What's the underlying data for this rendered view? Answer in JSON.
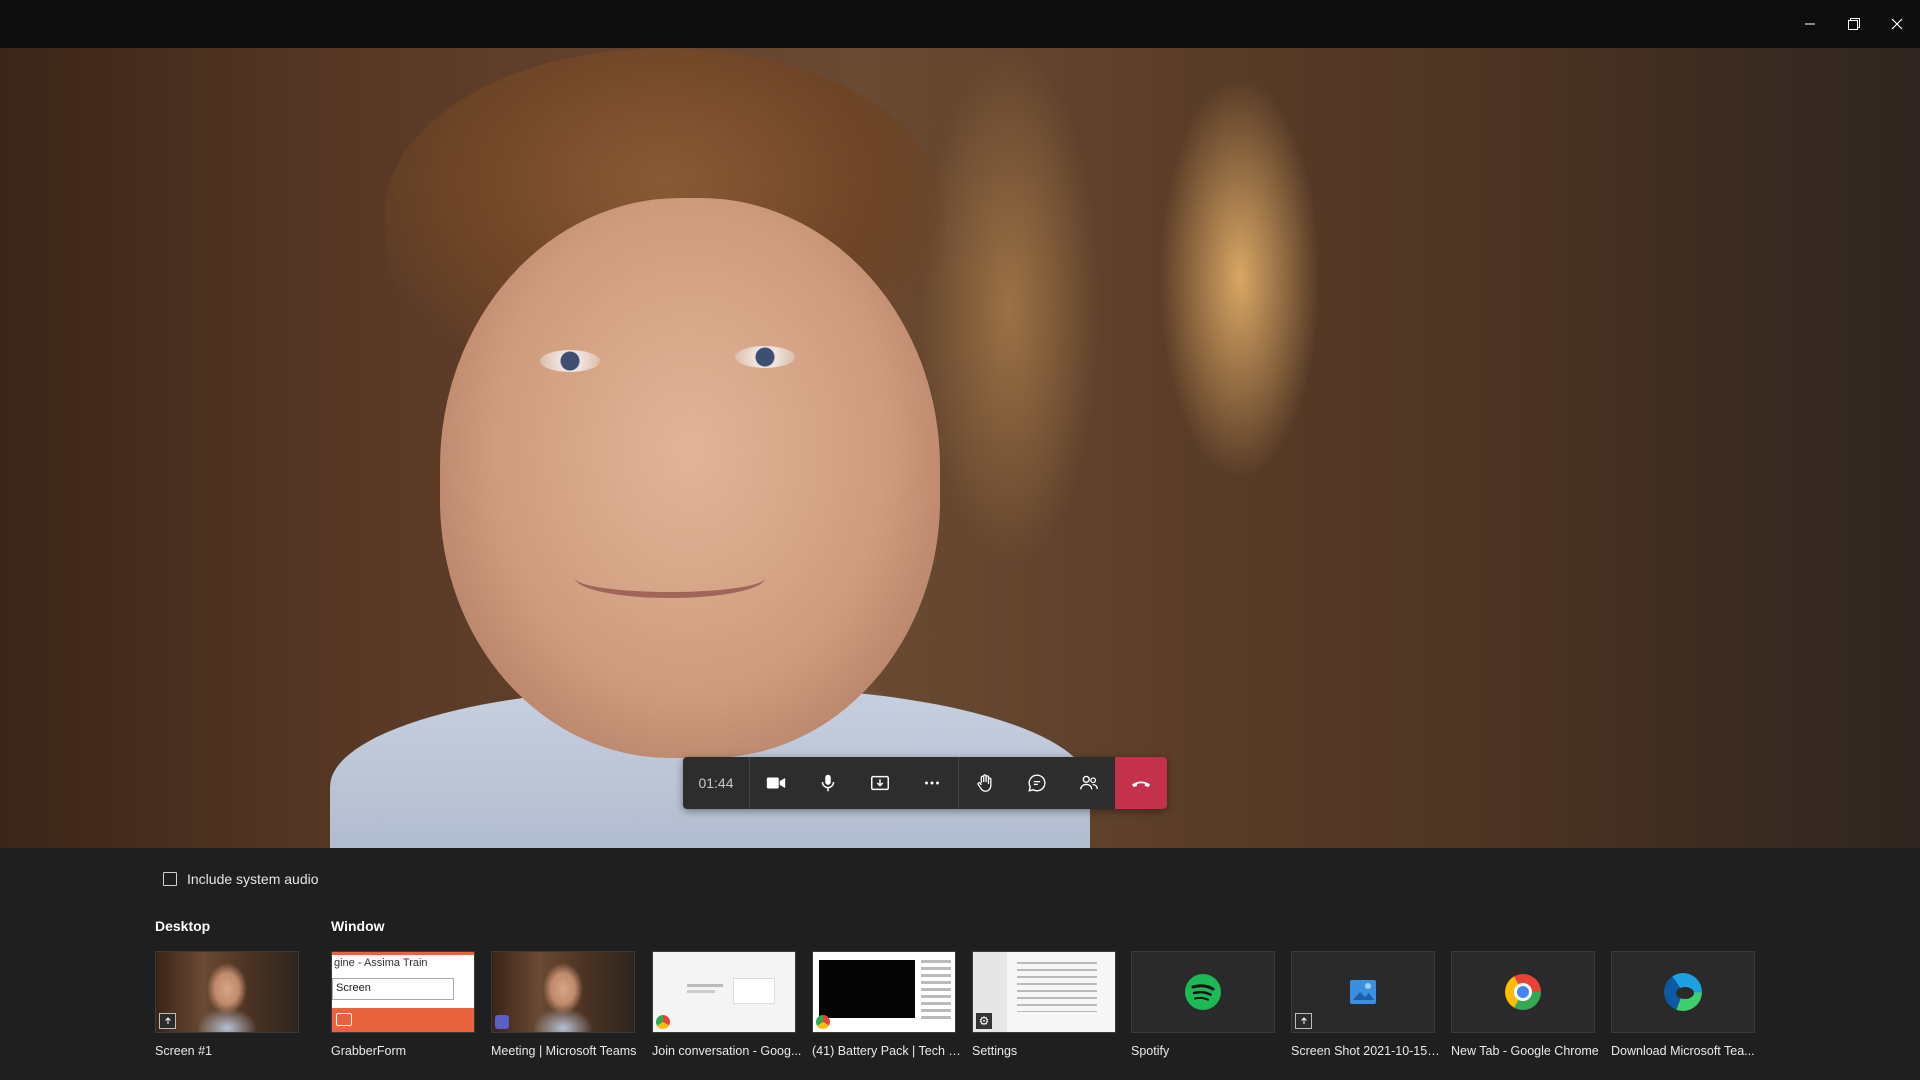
{
  "call": {
    "timer": "01:44"
  },
  "share_tray": {
    "include_audio_label": "Include system audio",
    "desktop_heading": "Desktop",
    "window_heading": "Window",
    "desktop_items": [
      {
        "label": "Screen #1"
      }
    ],
    "window_items": [
      {
        "label": "GrabberForm",
        "thumb_text_1": "gine - Assima Train",
        "thumb_text_2": "Screen"
      },
      {
        "label": "Meeting | Microsoft Teams"
      },
      {
        "label": "Join conversation - Goog..."
      },
      {
        "label": "(41) Battery Pack | Tech T..."
      },
      {
        "label": "Settings"
      },
      {
        "label": "Spotify"
      },
      {
        "label": "Screen Shot 2021-10-15 ..."
      },
      {
        "label": "New Tab - Google Chrome"
      },
      {
        "label": "Download Microsoft Tea..."
      }
    ]
  },
  "icons": {
    "window_controls": [
      "minimize-icon",
      "restore-icon",
      "close-icon"
    ],
    "toolbar": [
      "camera-icon",
      "microphone-icon",
      "share-tray-icon",
      "more-icon",
      "raise-hand-icon",
      "chat-icon",
      "participants-icon",
      "hang-up-icon"
    ]
  },
  "colors": {
    "hangup": "#c4314b",
    "titlebar": "#0d0d0d",
    "tray": "#1f1f1f",
    "spotify": "#1db954"
  }
}
